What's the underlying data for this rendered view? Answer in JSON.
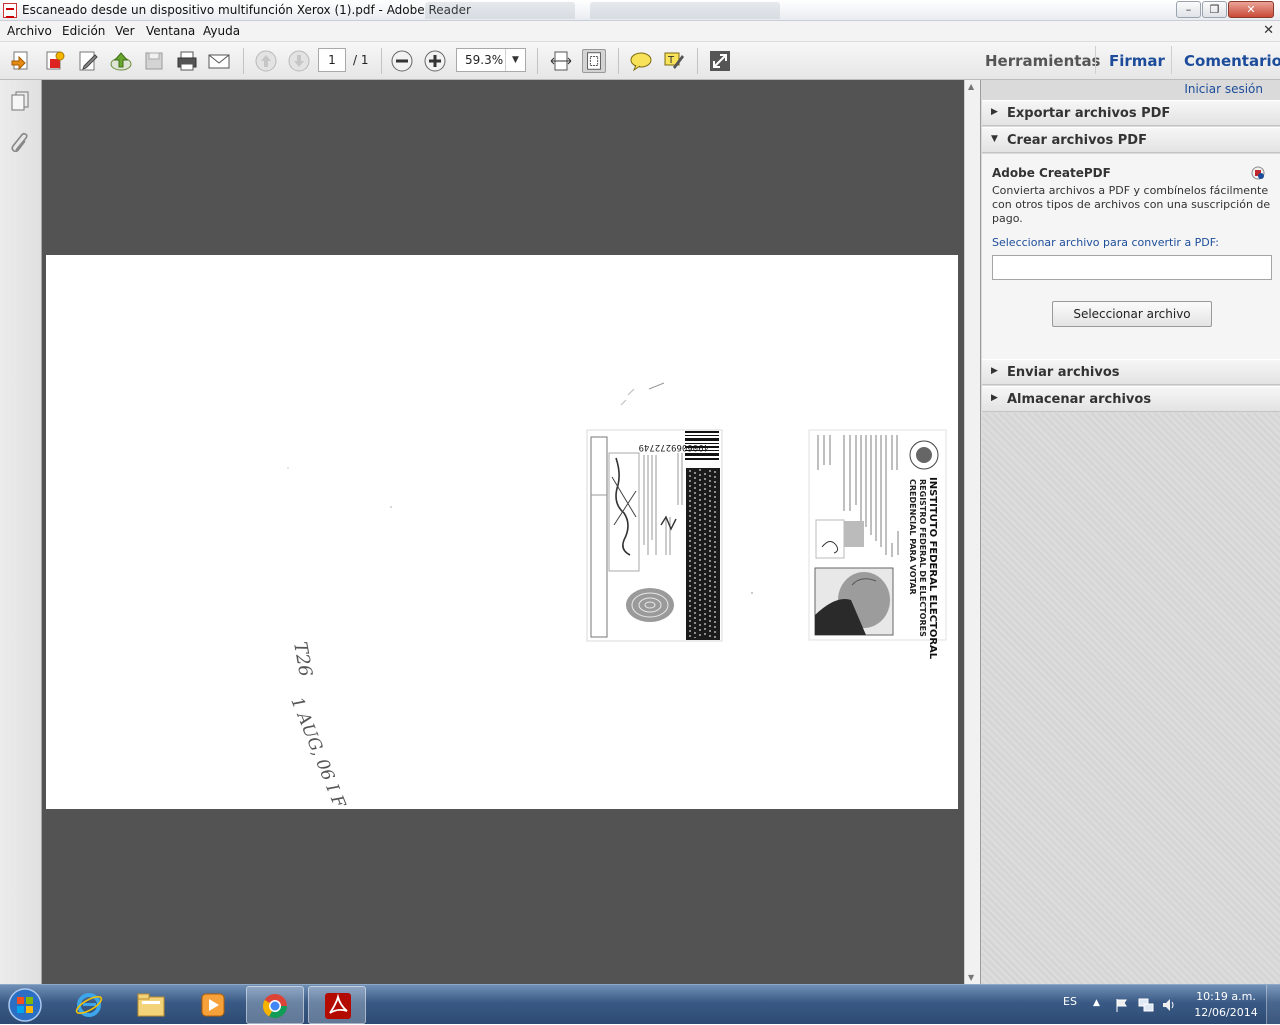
{
  "window": {
    "title": "Escaneado desde un dispositivo multifunción Xerox (1).pdf - Adobe Reader",
    "minimize_label": "–",
    "maximize_label": "❐",
    "close_label": "✕"
  },
  "menu": {
    "items": [
      "Archivo",
      "Edición",
      "Ver",
      "Ventana",
      "Ayuda"
    ],
    "close_label": "✕"
  },
  "toolbar": {
    "page_number": "1",
    "page_total": "/ 1",
    "zoom_value": "59.3%",
    "zoom_dropdown": "▼",
    "tabs": [
      "Herramientas",
      "Firmar",
      "Comentario"
    ]
  },
  "right_pane": {
    "signin": "Iniciar sesión",
    "sections": [
      {
        "label": "Exportar archivos PDF",
        "expanded": false
      },
      {
        "label": "Crear archivos PDF",
        "expanded": true
      },
      {
        "label": "Enviar archivos",
        "expanded": false
      },
      {
        "label": "Almacenar archivos",
        "expanded": false
      }
    ],
    "create": {
      "heading": "Adobe CreatePDF",
      "description": "Convierta archivos a PDF y combínelos fácilmente con otros tipos de archivos con una suscripción de pago.",
      "file_label": "Seleccionar archivo para convertir a PDF:",
      "file_value": "",
      "button": "Seleccionar archivo"
    }
  },
  "document": {
    "card_front": {
      "header": [
        "INSTITUTO FEDERAL ELECTORAL",
        "REGISTRO FEDERAL DE ELECTORES",
        "CREDENCIAL PARA VOTAR"
      ]
    },
    "card_back": {
      "code": "4906069272749"
    },
    "handwriting": [
      "T26",
      "1 AUG, 06 I F"
    ]
  },
  "taskbar": {
    "language": "ES",
    "time": "10:19 a.m.",
    "date": "12/06/2014"
  },
  "colors": {
    "doc_background": "#535353",
    "tab_blue": "#1d4d9a",
    "taskbar": "#3a5a85"
  }
}
